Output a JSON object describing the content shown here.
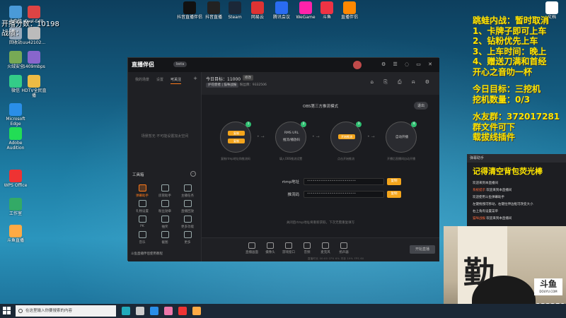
{
  "desktop": {
    "icons": [
      {
        "label": "此电脑",
        "color": "#4a9ad8"
      },
      {
        "label": "Cool-Edit",
        "color": "#d44"
      },
      {
        "label": "回收站",
        "color": "#9ab"
      },
      {
        "label": "uu42102...",
        "color": "#bbb"
      },
      {
        "label": "火绒安全",
        "color": "#7a5"
      },
      {
        "label": "1409mbps",
        "color": "#86c"
      },
      {
        "label": "微信",
        "color": "#3c8"
      },
      {
        "label": "HDTV全民直播",
        "color": "#eb4"
      },
      {
        "label": "Microsoft Edge",
        "color": "#2a8ee8"
      },
      {
        "label": "Adobe Audition",
        "color": "#2d5"
      },
      {
        "label": "WPS Office",
        "color": "#e33"
      },
      {
        "label": "工作室",
        "color": "#3a6"
      },
      {
        "label": "斗鱼直播",
        "color": "#fa4"
      }
    ],
    "top_icons": [
      {
        "label": "抖音直播伴侣",
        "color": "#111"
      },
      {
        "label": "抖音直播",
        "color": "#222"
      },
      {
        "label": "Steam",
        "color": "#1b2838"
      },
      {
        "label": "网易云",
        "color": "#d33"
      },
      {
        "label": "腾讯会议",
        "color": "#2a6cf0"
      },
      {
        "label": "WeGame",
        "color": "#f2a"
      },
      {
        "label": "斗鱼",
        "color": "#e34"
      },
      {
        "label": "直播伴侣",
        "color": "#f80"
      },
      {
        "label": "文档",
        "color": "#fff"
      }
    ]
  },
  "overlay": {
    "score": "开播分数：10198",
    "record": "战绩："
  },
  "notice": {
    "lines": [
      "跳蛙内战：暂时取消",
      "1、卡牌子即可上车",
      "2、钻粉优先上车",
      "3、上车时间：晚上",
      "4、赠送刀满和首经",
      "开心之音叻一杯"
    ],
    "goal_lines": [
      "今日目标：三挖机",
      "挖机数量：0/3"
    ],
    "fans_lines": [
      "水友群：372017281",
      "群文件可下",
      "载拔线插件"
    ]
  },
  "app": {
    "logo": "直播伴侣",
    "logo_badge": "beta",
    "tabs": [
      "我的场景",
      "设置",
      "可关注"
    ],
    "empty_text": "场景暂无 不可能设置加太空间",
    "tools_title": "工具箱",
    "tools": [
      {
        "label": "弹幕助手",
        "hot": true
      },
      {
        "label": "房管助手",
        "hot": false
      },
      {
        "label": "主播任务",
        "hot": false
      },
      {
        "label": "礼物设置",
        "hot": false
      },
      {
        "label": "粉丝勋章",
        "hot": false
      },
      {
        "label": "直播回放",
        "hot": false
      },
      {
        "label": "PK",
        "hot": false
      },
      {
        "label": "抽奖",
        "hot": false
      },
      {
        "label": "更多功能",
        "hot": false
      },
      {
        "label": "音乐",
        "hot": false
      },
      {
        "label": "截图",
        "hot": false
      },
      {
        "label": "更多",
        "hot": false
      }
    ],
    "sidebar_footer": "斗鱼直播伴侣使用教程",
    "goal_label": "今日目标：11000",
    "goal_btn": "修改",
    "subline_tag": "护花使者 | 猫咪战报",
    "subline_rest": "粉丝牌：9332506",
    "obs_title": "OBS第三方推流模式",
    "exit_btn": "退出",
    "steps": [
      {
        "num": "1",
        "lines": [
          "复制",
          "复制"
        ],
        "desc": "复制rtmp地址和推流码"
      },
      {
        "num": "2",
        "lines": [
          "RMS URL",
          "推流/播放码"
        ],
        "desc": "填入OBS推流设置"
      },
      {
        "num": "3",
        "lines": [
          "开始推流"
        ],
        "desc": "点击开始推流"
      },
      {
        "num": "4",
        "lines": [
          "自动开播"
        ],
        "desc": "开播后直播间自动开播"
      }
    ],
    "fields": [
      {
        "label": "rtmp地址",
        "value": "••••••••••••••••••••••••••",
        "btn": "复制"
      },
      {
        "label": "推流码",
        "value": "••••••••••••••••••••••••••",
        "btn": "复制"
      }
    ],
    "field_note": "关闭后rtmp地址将重新获取，下次无需重复填写",
    "bottom_tools": [
      "直播画面",
      "摄像头",
      "游戏窗口",
      "音频",
      "麦克风",
      "扬声器"
    ],
    "live_btn": "开始直播",
    "status": "直播时长 00:00  CPU 6%  内存 19%  FPS 60"
  },
  "chat": {
    "header": "弹幕助手",
    "big": "记得清空背包荧光棒",
    "lines": [
      {
        "pre": "欢迎来到",
        "hi": "",
        "post": "本直播间"
      },
      {
        "pre": "",
        "hi": "系统提示",
        "post": " 欢迎来到本直播间"
      },
      {
        "pre": "欢迎使用斗鱼弹幕助手",
        "hi": "",
        "post": ""
      },
      {
        "pre": "左键拖拽可移动，右键拉伸边框可改变大小",
        "hi": "",
        "post": ""
      },
      {
        "pre": "右上角有设置菜单",
        "hi": "",
        "post": ""
      },
      {
        "pre": "",
        "hi": "猫咪战报",
        "post": " 欢迎来到本直播间"
      }
    ]
  },
  "cam": {
    "brush": "勤",
    "logo": "斗鱼",
    "logo_sub": "DOUYU.COM",
    "room_id": "9332506"
  },
  "taskbar": {
    "search_placeholder": "在这里输入你要搜索的内容",
    "apps": [
      "#2ab",
      "#ccc",
      "#2a8ee8",
      "#e7a",
      "#e33",
      "#fa4"
    ]
  }
}
